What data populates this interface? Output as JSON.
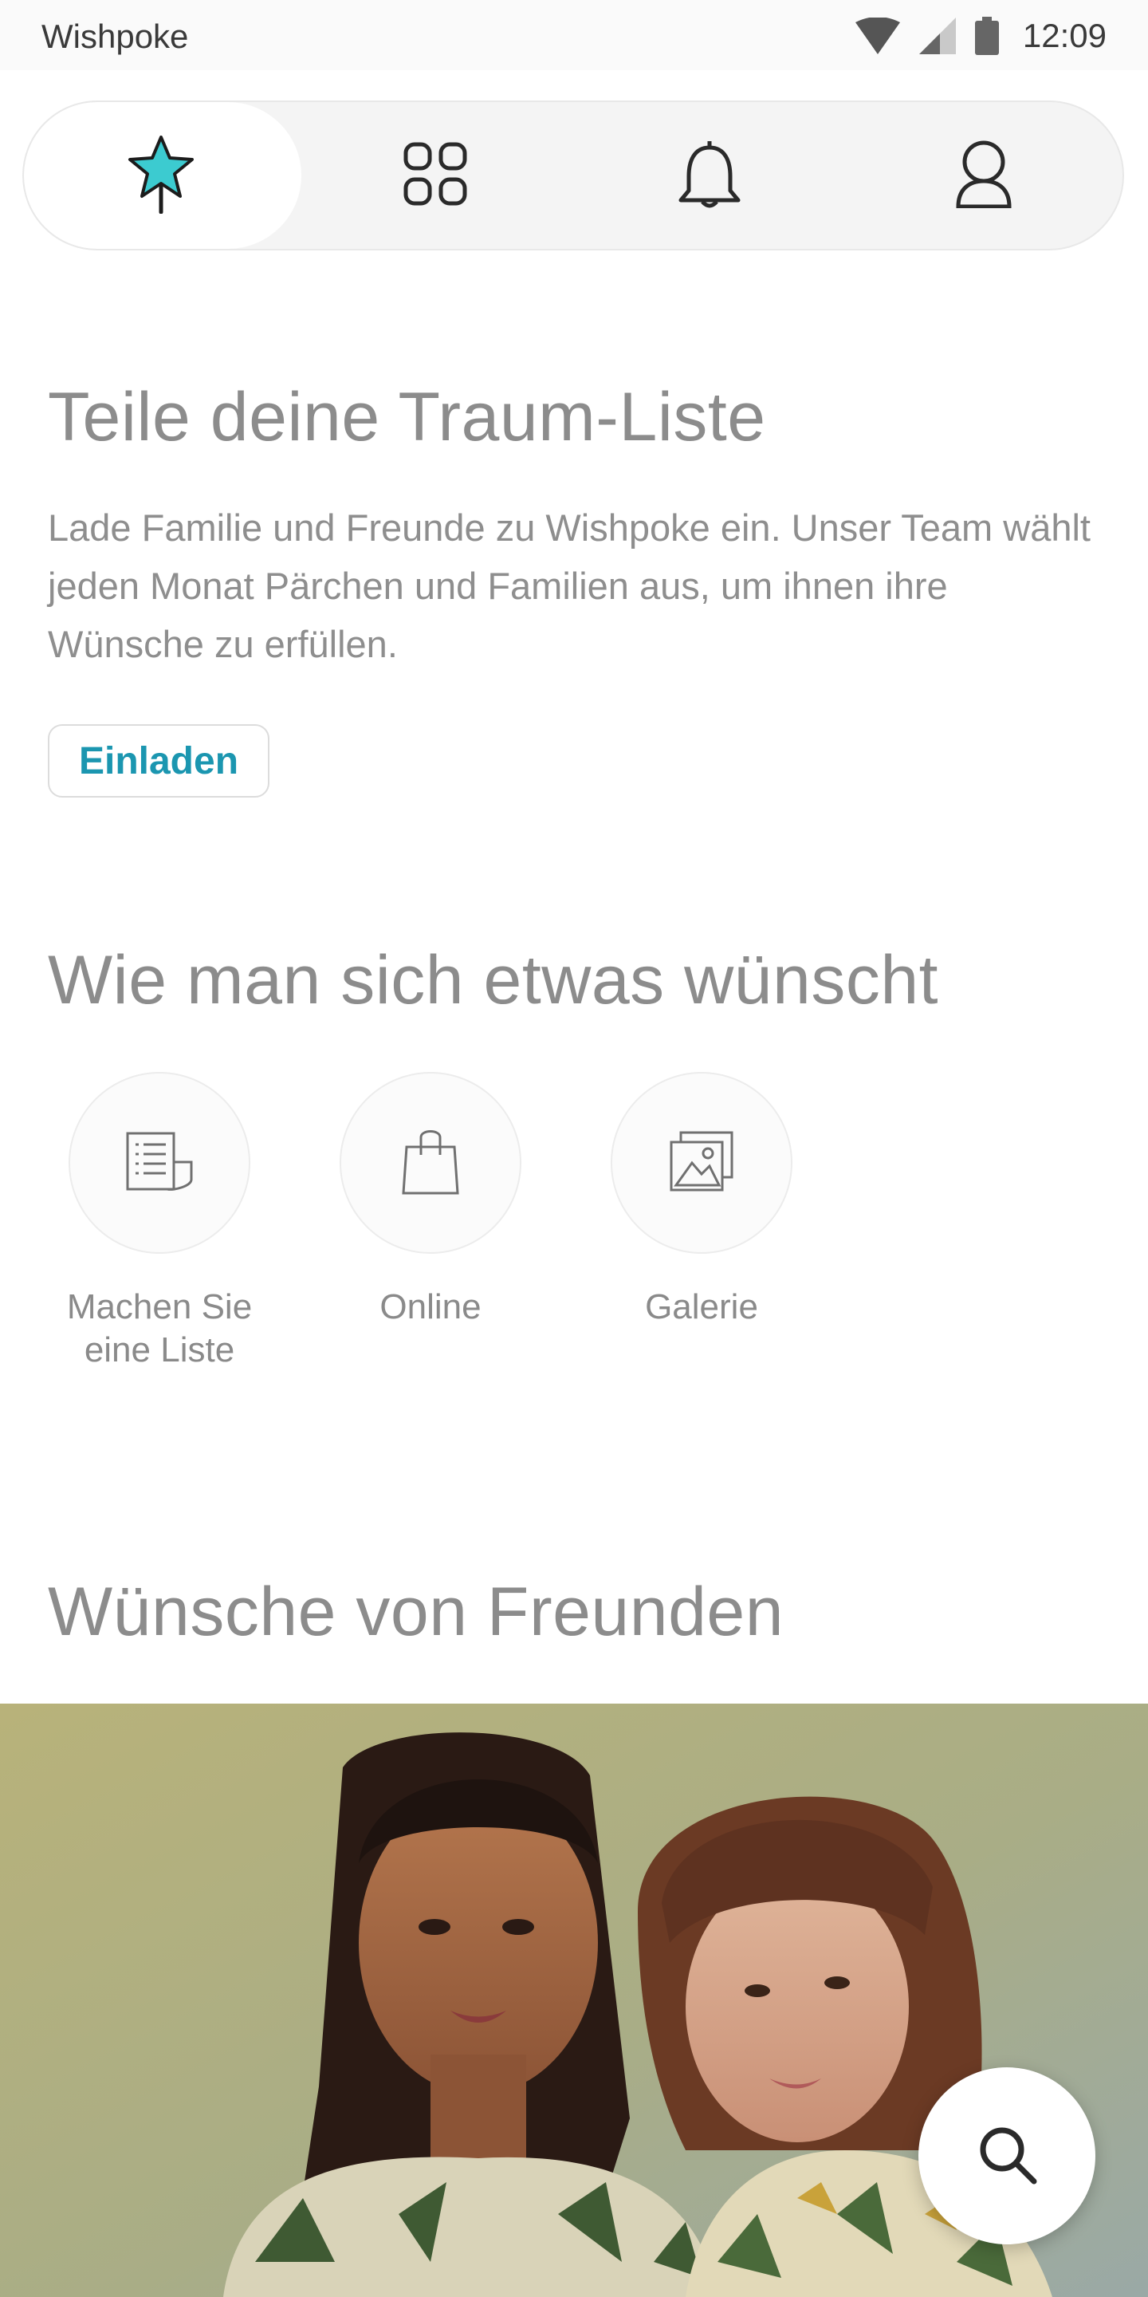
{
  "status_bar": {
    "app_name": "Wishpoke",
    "time": "12:09",
    "icons": [
      "wifi-icon",
      "cell-signal-icon",
      "battery-icon"
    ]
  },
  "nav": {
    "tabs": [
      {
        "name": "wishes",
        "icon": "star-wand-icon",
        "active": true
      },
      {
        "name": "categories",
        "icon": "grid-icon",
        "active": false
      },
      {
        "name": "notifications",
        "icon": "bell-icon",
        "active": false
      },
      {
        "name": "profile",
        "icon": "user-icon",
        "active": false
      }
    ]
  },
  "share": {
    "title": "Teile deine Traum-Liste",
    "description": "Lade Familie und Freunde zu Wishpoke ein. Unser Team wählt jeden Monat Pärchen und Familien aus, um ihnen ihre Wünsche zu erfüllen.",
    "invite_label": "Einladen"
  },
  "howto": {
    "title": "Wie man sich etwas wünscht",
    "items": [
      {
        "label": "Machen Sie eine Liste",
        "icon": "list-scroll-icon"
      },
      {
        "label": "Online",
        "icon": "shopping-bag-icon"
      },
      {
        "label": "Galerie",
        "icon": "gallery-icon"
      }
    ]
  },
  "friends": {
    "title": "Wünsche von Freunden"
  },
  "colors": {
    "accent": "#1b96b0",
    "star": "#3ccbd0",
    "heading": "#8c8c8c",
    "nav_bg": "#f4f4f4"
  },
  "fab": {
    "icon": "search-icon"
  }
}
